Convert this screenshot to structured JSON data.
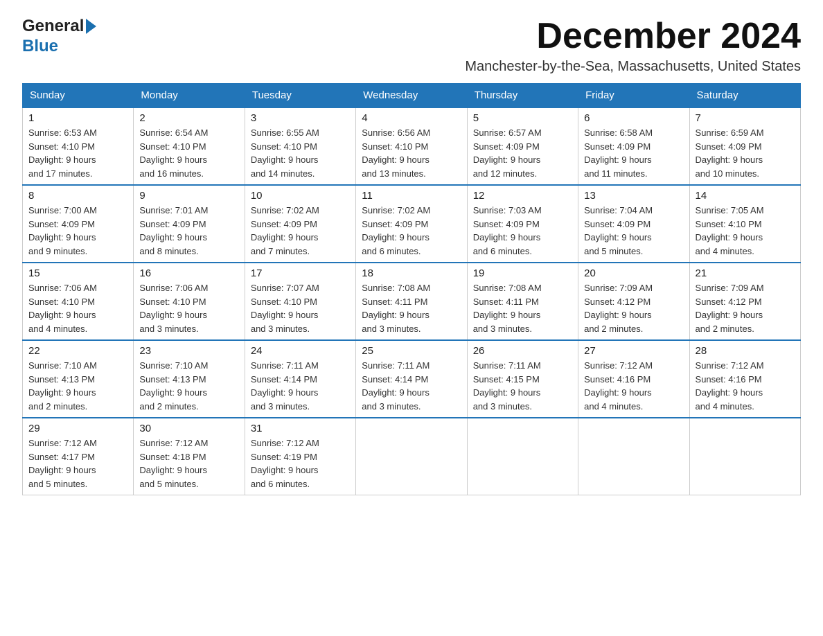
{
  "logo": {
    "line1": "General",
    "line2": "Blue"
  },
  "title": "December 2024",
  "subtitle": "Manchester-by-the-Sea, Massachusetts, United States",
  "days": [
    "Sunday",
    "Monday",
    "Tuesday",
    "Wednesday",
    "Thursday",
    "Friday",
    "Saturday"
  ],
  "weeks": [
    [
      {
        "num": "1",
        "info": "Sunrise: 6:53 AM\nSunset: 4:10 PM\nDaylight: 9 hours\nand 17 minutes."
      },
      {
        "num": "2",
        "info": "Sunrise: 6:54 AM\nSunset: 4:10 PM\nDaylight: 9 hours\nand 16 minutes."
      },
      {
        "num": "3",
        "info": "Sunrise: 6:55 AM\nSunset: 4:10 PM\nDaylight: 9 hours\nand 14 minutes."
      },
      {
        "num": "4",
        "info": "Sunrise: 6:56 AM\nSunset: 4:10 PM\nDaylight: 9 hours\nand 13 minutes."
      },
      {
        "num": "5",
        "info": "Sunrise: 6:57 AM\nSunset: 4:09 PM\nDaylight: 9 hours\nand 12 minutes."
      },
      {
        "num": "6",
        "info": "Sunrise: 6:58 AM\nSunset: 4:09 PM\nDaylight: 9 hours\nand 11 minutes."
      },
      {
        "num": "7",
        "info": "Sunrise: 6:59 AM\nSunset: 4:09 PM\nDaylight: 9 hours\nand 10 minutes."
      }
    ],
    [
      {
        "num": "8",
        "info": "Sunrise: 7:00 AM\nSunset: 4:09 PM\nDaylight: 9 hours\nand 9 minutes."
      },
      {
        "num": "9",
        "info": "Sunrise: 7:01 AM\nSunset: 4:09 PM\nDaylight: 9 hours\nand 8 minutes."
      },
      {
        "num": "10",
        "info": "Sunrise: 7:02 AM\nSunset: 4:09 PM\nDaylight: 9 hours\nand 7 minutes."
      },
      {
        "num": "11",
        "info": "Sunrise: 7:02 AM\nSunset: 4:09 PM\nDaylight: 9 hours\nand 6 minutes."
      },
      {
        "num": "12",
        "info": "Sunrise: 7:03 AM\nSunset: 4:09 PM\nDaylight: 9 hours\nand 6 minutes."
      },
      {
        "num": "13",
        "info": "Sunrise: 7:04 AM\nSunset: 4:09 PM\nDaylight: 9 hours\nand 5 minutes."
      },
      {
        "num": "14",
        "info": "Sunrise: 7:05 AM\nSunset: 4:10 PM\nDaylight: 9 hours\nand 4 minutes."
      }
    ],
    [
      {
        "num": "15",
        "info": "Sunrise: 7:06 AM\nSunset: 4:10 PM\nDaylight: 9 hours\nand 4 minutes."
      },
      {
        "num": "16",
        "info": "Sunrise: 7:06 AM\nSunset: 4:10 PM\nDaylight: 9 hours\nand 3 minutes."
      },
      {
        "num": "17",
        "info": "Sunrise: 7:07 AM\nSunset: 4:10 PM\nDaylight: 9 hours\nand 3 minutes."
      },
      {
        "num": "18",
        "info": "Sunrise: 7:08 AM\nSunset: 4:11 PM\nDaylight: 9 hours\nand 3 minutes."
      },
      {
        "num": "19",
        "info": "Sunrise: 7:08 AM\nSunset: 4:11 PM\nDaylight: 9 hours\nand 3 minutes."
      },
      {
        "num": "20",
        "info": "Sunrise: 7:09 AM\nSunset: 4:12 PM\nDaylight: 9 hours\nand 2 minutes."
      },
      {
        "num": "21",
        "info": "Sunrise: 7:09 AM\nSunset: 4:12 PM\nDaylight: 9 hours\nand 2 minutes."
      }
    ],
    [
      {
        "num": "22",
        "info": "Sunrise: 7:10 AM\nSunset: 4:13 PM\nDaylight: 9 hours\nand 2 minutes."
      },
      {
        "num": "23",
        "info": "Sunrise: 7:10 AM\nSunset: 4:13 PM\nDaylight: 9 hours\nand 2 minutes."
      },
      {
        "num": "24",
        "info": "Sunrise: 7:11 AM\nSunset: 4:14 PM\nDaylight: 9 hours\nand 3 minutes."
      },
      {
        "num": "25",
        "info": "Sunrise: 7:11 AM\nSunset: 4:14 PM\nDaylight: 9 hours\nand 3 minutes."
      },
      {
        "num": "26",
        "info": "Sunrise: 7:11 AM\nSunset: 4:15 PM\nDaylight: 9 hours\nand 3 minutes."
      },
      {
        "num": "27",
        "info": "Sunrise: 7:12 AM\nSunset: 4:16 PM\nDaylight: 9 hours\nand 4 minutes."
      },
      {
        "num": "28",
        "info": "Sunrise: 7:12 AM\nSunset: 4:16 PM\nDaylight: 9 hours\nand 4 minutes."
      }
    ],
    [
      {
        "num": "29",
        "info": "Sunrise: 7:12 AM\nSunset: 4:17 PM\nDaylight: 9 hours\nand 5 minutes."
      },
      {
        "num": "30",
        "info": "Sunrise: 7:12 AM\nSunset: 4:18 PM\nDaylight: 9 hours\nand 5 minutes."
      },
      {
        "num": "31",
        "info": "Sunrise: 7:12 AM\nSunset: 4:19 PM\nDaylight: 9 hours\nand 6 minutes."
      },
      {
        "num": "",
        "info": ""
      },
      {
        "num": "",
        "info": ""
      },
      {
        "num": "",
        "info": ""
      },
      {
        "num": "",
        "info": ""
      }
    ]
  ]
}
